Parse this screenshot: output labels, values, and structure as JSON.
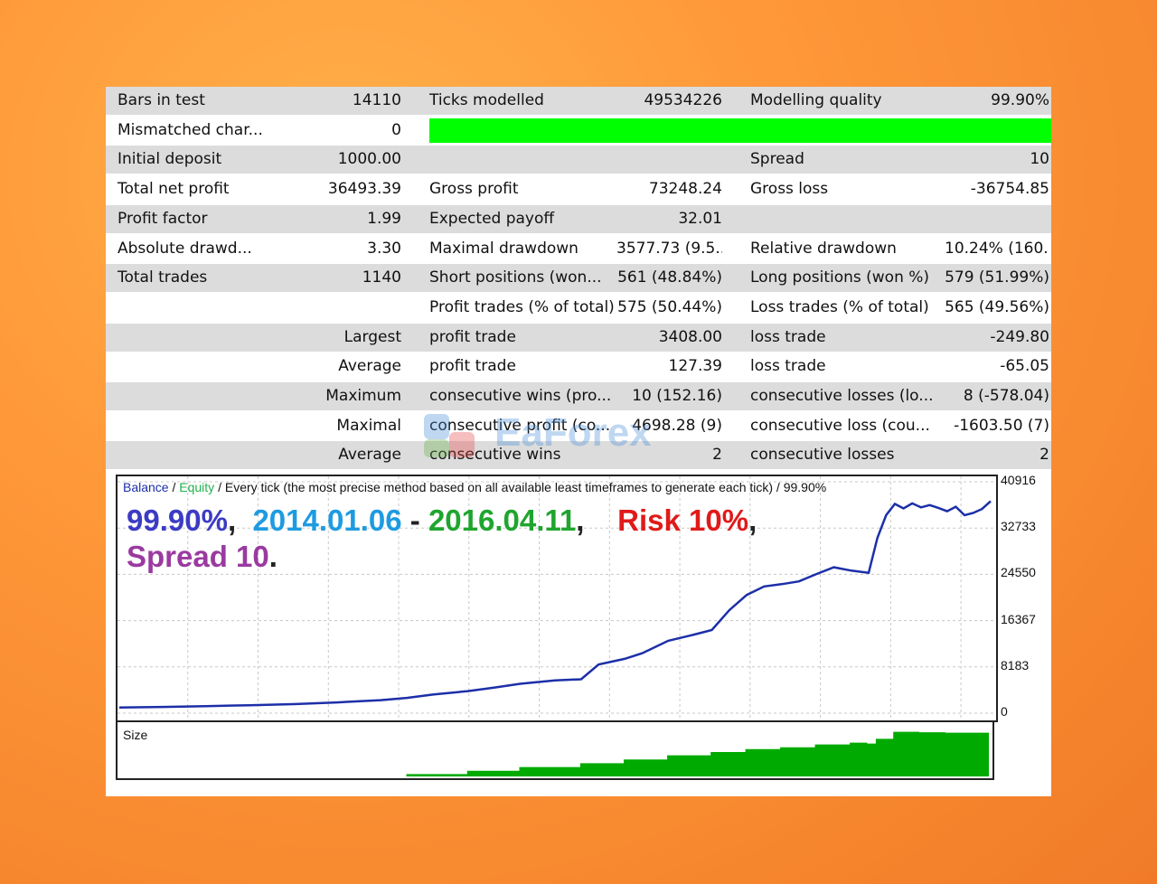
{
  "report": {
    "rows": [
      {
        "l1": "Bars in test",
        "v1": "14110",
        "l2": "Ticks modelled",
        "v2": "49534226",
        "l3": "Modelling quality",
        "v3": "99.90%"
      },
      {
        "l1": "Mismatched char...",
        "v1": "0"
      },
      {
        "l1": "Initial deposit",
        "v1": "1000.00",
        "l2": "",
        "v2": "",
        "l3": "Spread",
        "v3": "10"
      },
      {
        "l1": "Total net profit",
        "v1": "36493.39",
        "l2": "Gross profit",
        "v2": "73248.24",
        "l3": "Gross loss",
        "v3": "-36754.85"
      },
      {
        "l1": "Profit factor",
        "v1": "1.99",
        "l2": "Expected payoff",
        "v2": "32.01",
        "l3": "",
        "v3": ""
      },
      {
        "l1": "Absolute drawd...",
        "v1": "3.30",
        "l2": "Maximal drawdown",
        "v2": "3577.73 (9.5...",
        "l3": "Relative drawdown",
        "v3": "10.24% (160...."
      },
      {
        "l1": "Total trades",
        "v1": "1140",
        "l2": "Short positions (won...",
        "v2": "561 (48.84%)",
        "l3": "Long positions (won %)",
        "v3": "579 (51.99%)"
      },
      {
        "l1": "",
        "v1": "",
        "l2": "Profit trades (% of total)",
        "v2": "575 (50.44%)",
        "l3": "Loss trades (% of total)",
        "v3": "565 (49.56%)"
      },
      {
        "r": "Largest",
        "l2": "profit trade",
        "v2": "3408.00",
        "l3": "loss trade",
        "v3": "-249.80"
      },
      {
        "r": "Average",
        "l2": "profit trade",
        "v2": "127.39",
        "l3": "loss trade",
        "v3": "-65.05"
      },
      {
        "r": "Maximum",
        "l2": "consecutive wins (pro...",
        "v2": "10 (152.16)",
        "l3": "consecutive losses (lo...",
        "v3": "8 (-578.04)"
      },
      {
        "r": "Maximal",
        "l2": "consecutive profit (co...",
        "v2": "4698.28 (9)",
        "l3": "consecutive loss (cou...",
        "v3": "-1603.50 (7)"
      },
      {
        "r": "Average",
        "l2": "consecutive wins",
        "v2": "2",
        "l3": "consecutive losses",
        "v3": "2"
      }
    ],
    "modelling_quality_fill": 1.0,
    "bar_color": "#00ff00"
  },
  "chart": {
    "legend_balance": "Balance",
    "legend_sep": " / ",
    "legend_equity": "Equity",
    "legend_rest": " / Every tick (the most precise method based on all available least timeframes to generate each tick) / 99.90%",
    "headline": {
      "quality": "99.90%",
      "sep1": ",",
      "from": "2014.01.06",
      "dash": " - ",
      "to": "2016.04.11",
      "sep2": ",",
      "risk": "Risk 10%",
      "sep3": ",",
      "spread": "Spread 10",
      "dot": "."
    },
    "colors": {
      "quality": "#3b3bc4",
      "from": "#1e9be0",
      "to": "#1fa52e",
      "risk": "#e01a1a",
      "spread": "#9a3aa0",
      "balance": "#1c2fa8",
      "size": "#00aa00"
    },
    "size_label": "Size"
  },
  "chart_data": {
    "type": "line",
    "title": "",
    "xlabel": "",
    "ylabel": "",
    "yticks": [
      "40916",
      "32733",
      "24550",
      "16367",
      "8183",
      "0"
    ],
    "ylim": [
      0,
      40916
    ],
    "series": [
      {
        "name": "Balance",
        "x": [
          0,
          5,
          10,
          15,
          20,
          25,
          30,
          33,
          36,
          40,
          43,
          46,
          50,
          53,
          55,
          58,
          60,
          63,
          66,
          68,
          70,
          72,
          74,
          76,
          78,
          80,
          82,
          84,
          86,
          87,
          88,
          89,
          90,
          91,
          92,
          93,
          94,
          95,
          96,
          97,
          98,
          99,
          100
        ],
        "values": [
          1000,
          1100,
          1250,
          1400,
          1600,
          1900,
          2300,
          2700,
          3300,
          3900,
          4500,
          5200,
          5800,
          6000,
          8600,
          9600,
          10600,
          12800,
          13900,
          14700,
          18200,
          20900,
          22400,
          22800,
          23300,
          24600,
          25800,
          25200,
          24800,
          31000,
          35000,
          37000,
          36200,
          37100,
          36400,
          36800,
          36300,
          35700,
          36500,
          35000,
          35400,
          36100,
          37500
        ]
      },
      {
        "name": "Size",
        "x": [
          0,
          20,
          33,
          40,
          46,
          53,
          58,
          63,
          68,
          72,
          76,
          80,
          84,
          86,
          87,
          89,
          92,
          95,
          100
        ],
        "values": [
          0,
          0,
          0.05,
          0.12,
          0.2,
          0.28,
          0.36,
          0.45,
          0.52,
          0.58,
          0.62,
          0.68,
          0.72,
          0.7,
          0.8,
          0.95,
          0.94,
          0.93,
          0.93
        ]
      }
    ],
    "x_range": [
      0,
      100
    ]
  },
  "watermark": {
    "text": "EaForex"
  }
}
